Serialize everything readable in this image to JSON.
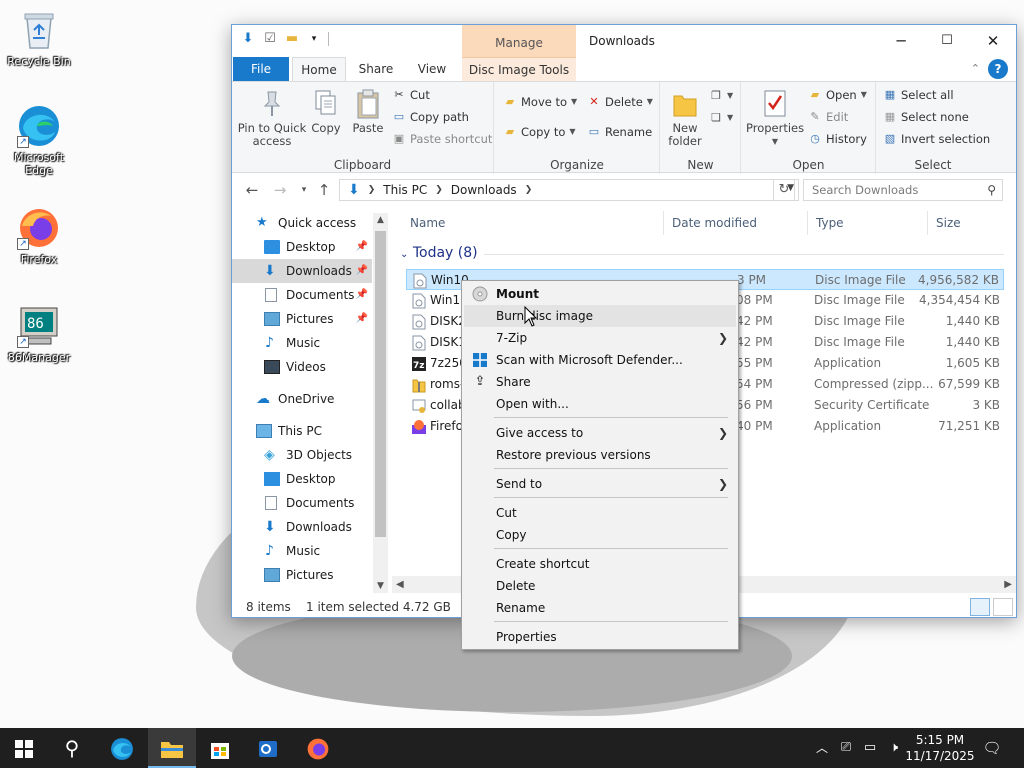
{
  "desktop": {
    "icons": [
      {
        "label": "Recycle Bin"
      },
      {
        "label": "Microsoft Edge"
      },
      {
        "label": "Firefox"
      },
      {
        "label": "86Manager"
      }
    ]
  },
  "window": {
    "title": "Downloads",
    "manage_tab": "Manage",
    "minimize": "─",
    "maximize": "☐",
    "close": "✕"
  },
  "ribbon": {
    "tabs": {
      "file": "File",
      "home": "Home",
      "share": "Share",
      "view": "View",
      "disc_tools": "Disc Image Tools"
    },
    "clipboard": {
      "pin": "Pin to Quick access",
      "copy": "Copy",
      "paste": "Paste",
      "cut": "Cut",
      "copy_path": "Copy path",
      "paste_shortcut": "Paste shortcut",
      "group": "Clipboard"
    },
    "organize": {
      "move_to": "Move to",
      "copy_to": "Copy to",
      "delete": "Delete",
      "rename": "Rename",
      "group": "Organize"
    },
    "new": {
      "new_folder": "New folder",
      "group": "New"
    },
    "open": {
      "properties": "Properties",
      "open": "Open",
      "edit": "Edit",
      "history": "History",
      "group": "Open"
    },
    "select": {
      "select_all": "Select all",
      "select_none": "Select none",
      "invert": "Invert selection",
      "group": "Select"
    }
  },
  "address": {
    "path": [
      "This PC",
      "Downloads"
    ],
    "search_placeholder": "Search Downloads"
  },
  "nav": {
    "quick_access": "Quick access",
    "quick_items": [
      "Desktop",
      "Downloads",
      "Documents",
      "Pictures",
      "Music",
      "Videos"
    ],
    "onedrive": "OneDrive",
    "this_pc": "This PC",
    "pc_items": [
      "3D Objects",
      "Desktop",
      "Documents",
      "Downloads",
      "Music",
      "Pictures"
    ]
  },
  "files": {
    "columns": {
      "name": "Name",
      "date": "Date modified",
      "type": "Type",
      "size": "Size"
    },
    "group_label": "Today (8)",
    "rows": [
      {
        "name": "Win10",
        "date": "3 PM",
        "type": "Disc Image File",
        "size": "4,956,582 KB",
        "icon": "disc-image-icon"
      },
      {
        "name": "Win10",
        "date": "08 PM",
        "type": "Disc Image File",
        "size": "4,354,454 KB",
        "icon": "disc-image-icon"
      },
      {
        "name": "DISK2",
        "date": "42 PM",
        "type": "Disc Image File",
        "size": "1,440 KB",
        "icon": "disc-image-icon"
      },
      {
        "name": "DISK1",
        "date": "42 PM",
        "type": "Disc Image File",
        "size": "1,440 KB",
        "icon": "disc-image-icon"
      },
      {
        "name": "7z2501",
        "date": "55 PM",
        "type": "Application",
        "size": "1,605 KB",
        "icon": "7zip-icon"
      },
      {
        "name": "roms-",
        "date": "54 PM",
        "type": "Compressed (zipp...",
        "size": "67,599 KB",
        "icon": "zip-icon"
      },
      {
        "name": "collab",
        "date": "56 PM",
        "type": "Security Certificate",
        "size": "3 KB",
        "icon": "certificate-icon"
      },
      {
        "name": "Firefo",
        "date": "40 PM",
        "type": "Application",
        "size": "71,251 KB",
        "icon": "firefox-installer-icon"
      }
    ]
  },
  "status": {
    "count": "8 items",
    "selected": "1 item selected  4.72 GB"
  },
  "context_menu": {
    "mount": "Mount",
    "burn": "Burn disc image",
    "sevenzip": "7-Zip",
    "defender": "Scan with Microsoft Defender...",
    "share": "Share",
    "open_with": "Open with...",
    "give_access": "Give access to",
    "restore": "Restore previous versions",
    "send_to": "Send to",
    "cut": "Cut",
    "copy": "Copy",
    "create_shortcut": "Create shortcut",
    "delete": "Delete",
    "rename": "Rename",
    "properties": "Properties"
  },
  "taskbar": {
    "time": "5:15 PM",
    "date": "11/17/2025"
  },
  "colors": {
    "accent": "#1979ca",
    "selection": "#cce8ff",
    "manage_tab": "#fbd9bb",
    "taskbar": "#1f1f1f"
  }
}
